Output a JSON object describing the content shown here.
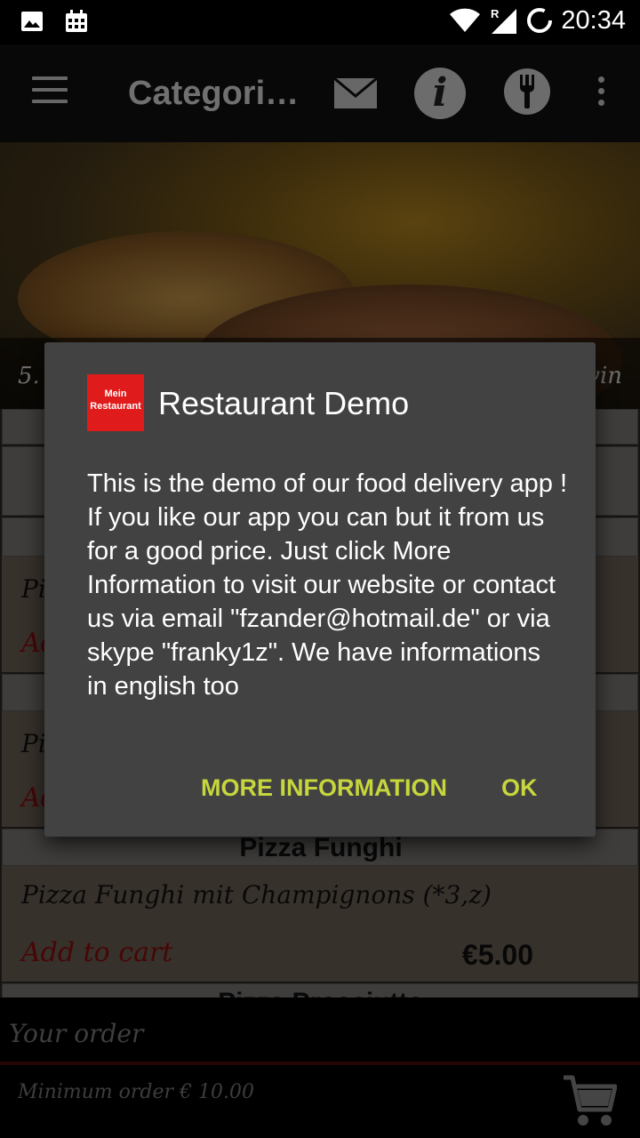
{
  "status_bar": {
    "time": "20:34",
    "roaming_label": "R"
  },
  "app_bar": {
    "title": "Categori…"
  },
  "banner": {
    "left_text": "5.",
    "right_text": "vin"
  },
  "list": {
    "items": [
      {
        "desc": "Pi",
        "add": "Ad"
      },
      {
        "desc": "Pi",
        "add": "Ad"
      },
      {
        "name": "Pizza Funghi",
        "desc": "Pizza Funghi mit Champignons (*3,z)",
        "add": "Add to cart",
        "price": "€5.00"
      },
      {
        "name": "Pizza Prosciutto"
      }
    ]
  },
  "order_bar": {
    "label": "Your order",
    "min_order": "Minimum order € 10.00"
  },
  "dialog": {
    "icon_text_line1": "Mein",
    "icon_text_line2": "Restaurant",
    "title": "Restaurant Demo",
    "message": "This is the demo of our food delivery app ! If you like our app you can but it from us for a good price. Just click More Information to visit our website or contact us via email \"fzander@hotmail.de\" or via skype \"franky1z\". We have informations in english too",
    "more_info_label": "MORE INFORMATION",
    "ok_label": "OK"
  },
  "colors": {
    "dialog_bg": "#424242",
    "accent": "#c6d63c",
    "brand_red": "#e01b1b",
    "add_to_cart": "#8c0c0c"
  },
  "icons": [
    "image-icon",
    "calendar-icon",
    "wifi-icon",
    "signal-icon",
    "sync-icon",
    "menu-icon",
    "mail-icon",
    "info-icon",
    "restaurant-icon",
    "overflow-icon",
    "cart-icon"
  ]
}
